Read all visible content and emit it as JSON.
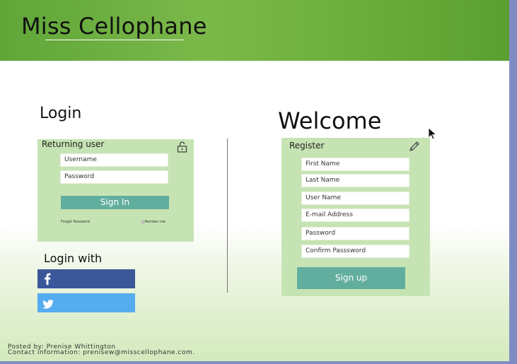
{
  "header": {
    "brand": "Miss Cellophane"
  },
  "login": {
    "title": "Login",
    "panel_label": "Returning user",
    "username_placeholder": "Username",
    "password_placeholder": "Password",
    "sign_in_label": "Sign In",
    "forgot_password": "Forgot Password",
    "remember_me": "Rember me",
    "icon": "unlock-icon"
  },
  "login_with": {
    "title": "Login with",
    "facebook_icon": "facebook-icon",
    "twitter_icon": "twitter-icon"
  },
  "register": {
    "title": "Welcome",
    "panel_label": "Register",
    "icon": "pencil-icon",
    "fields": [
      "First Name",
      "Last Name",
      "User Name",
      "E-mail Address",
      "Password",
      "Confirm Passsword"
    ],
    "sign_up_label": "Sign up"
  },
  "footer": {
    "posted_by": "Posted by: Prenise Whittington",
    "contact": "Contact information: prenisew@misscellophane.com."
  },
  "colors": {
    "header_green": "#6cae3c",
    "panel_green": "#c6e4b3",
    "button_teal": "#62ae9e",
    "facebook_blue": "#3a579a",
    "twitter_blue": "#55acee"
  }
}
